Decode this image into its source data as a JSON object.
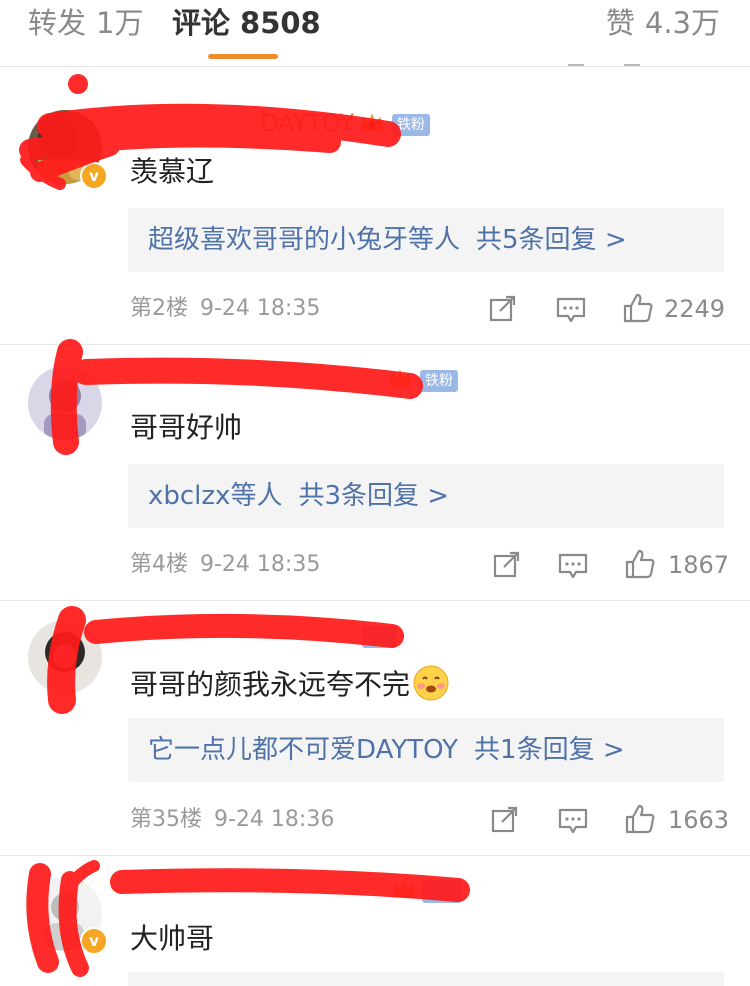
{
  "tabs": {
    "repost": {
      "label": "转发",
      "count": "1万"
    },
    "comments": {
      "label": "评论",
      "count": "8508"
    },
    "likes": {
      "label": "赞",
      "count": "4.3万"
    }
  },
  "colors": {
    "accent": "#f08c2c",
    "link": "#4f73a8",
    "username": "#eb7350",
    "fan_badge": "#9bb9e6",
    "redaction": "#ff1a1a"
  },
  "comments": [
    {
      "username_visible": "DAYTOY",
      "fan_badge": "铁粉",
      "verified_badge": "v",
      "text": "羡慕辽",
      "replies": {
        "users": "超级喜欢哥哥的小兔牙等人",
        "count": "共5条回复 >"
      },
      "floor": "第2楼",
      "time": "9-24 18:35",
      "likes": "2249"
    },
    {
      "fan_badge": "铁粉",
      "text": "哥哥好帅",
      "replies": {
        "users": "xbclzx等人",
        "count": "共3条回复 >"
      },
      "floor": "第4楼",
      "time": "9-24 18:35",
      "likes": "1867"
    },
    {
      "text": "哥哥的颜我永远夸不完",
      "emoji": "😊",
      "replies": {
        "users": "它一点儿都不可爱DAYTOY",
        "count": "共1条回复 >"
      },
      "floor": "第35楼",
      "time": "9-24 18:36",
      "likes": "1663"
    },
    {
      "verified_badge": "v",
      "text": "大帅哥"
    }
  ],
  "icons": [
    "share-icon",
    "comment-icon",
    "thumbs-up-icon",
    "crown-icon",
    "verified-icon",
    "shy-emoji-icon"
  ]
}
